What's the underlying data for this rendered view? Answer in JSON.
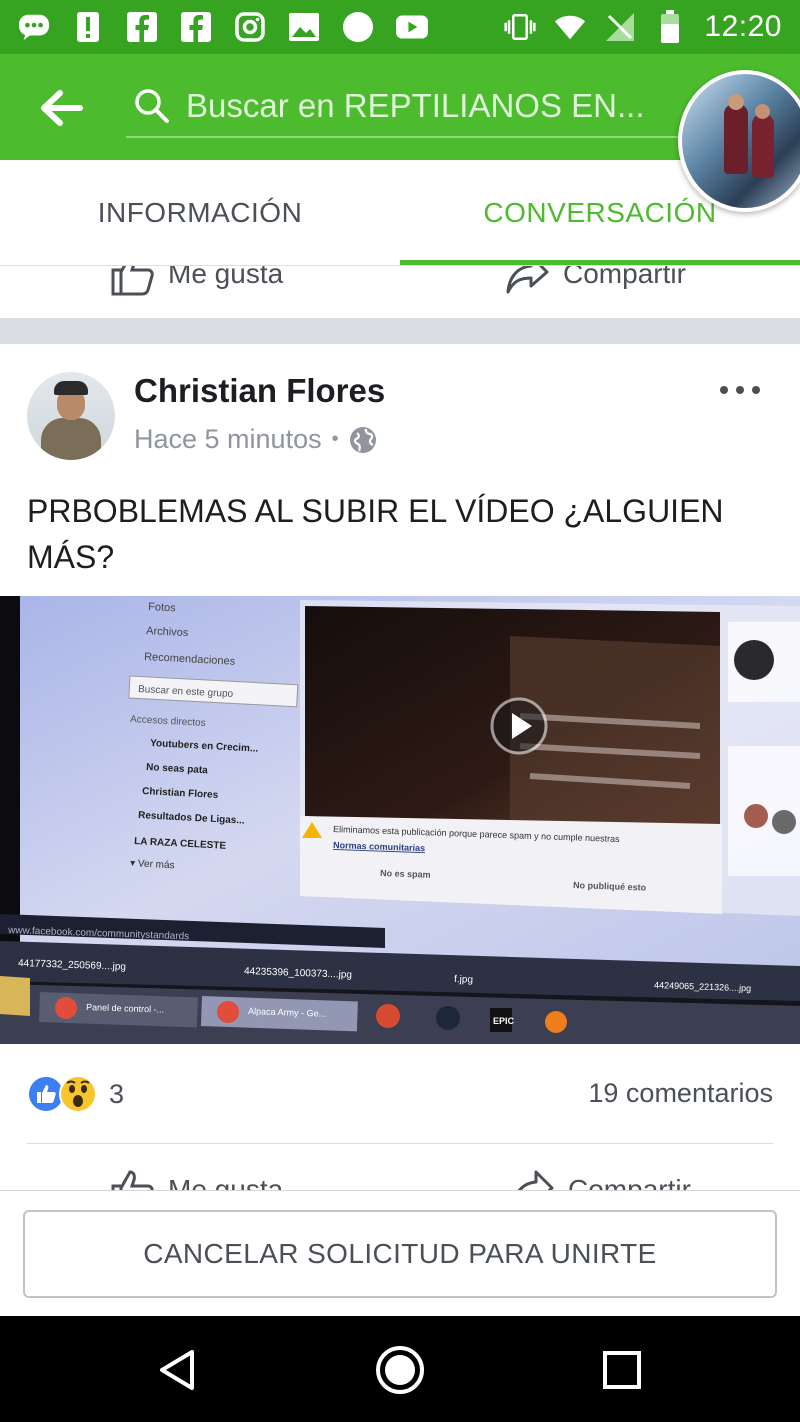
{
  "status_bar": {
    "time": "12:20",
    "icons": [
      "messenger-icon",
      "alert-icon",
      "facebook-icon",
      "facebook-icon",
      "instagram-icon",
      "gallery-icon",
      "circle-icon",
      "youtube-icon",
      "vibrate-icon",
      "wifi-icon",
      "no-signal-icon",
      "battery-icon"
    ]
  },
  "header": {
    "search_placeholder": "Buscar en REPTILIANOS EN..."
  },
  "tabs": [
    {
      "label": "INFORMACIÓN",
      "active": false
    },
    {
      "label": "CONVERSACIÓN",
      "active": true
    }
  ],
  "previous_post": {
    "like_label": "Me gusta",
    "share_label": "Compartir"
  },
  "post": {
    "author": "Christian Flores",
    "time": "Hace 5 minutos",
    "visibility_icon": "globe-icon",
    "text": "PRBOBLEMAS AL SUBIR EL VÍDEO ¿ALGUIEN MÁS?",
    "media": {
      "sidebar_items": [
        "Fotos",
        "Archivos",
        "Recomendaciones"
      ],
      "search_placeholder": "Buscar en este grupo",
      "shortcuts_title": "Accesos directos",
      "shortcuts": [
        "Youtubers en Crecim...",
        "No seas pata",
        "Christian Flores",
        "Resultados De Ligas...",
        "LA RAZA CELESTE"
      ],
      "see_more": "Ver más",
      "notice": "Eliminamos esta publicación porque parece spam y no cumple nuestras",
      "notice_link": "Normas comunitarias",
      "not_spam": "No es spam",
      "didnt_post": "No publiqué esto",
      "url": "www.facebook.com/communitystandards",
      "downloads": [
        "44177332_250569....jpg",
        "44235396_100373....jpg",
        "f.jpg",
        "44249065_221326....jpg"
      ],
      "taskbar": [
        "Panel de control -...",
        "Alpaca Army - Ge..."
      ],
      "epic_label": "EPIC"
    },
    "reaction_count": "3",
    "comments": "19 comentarios",
    "like_label": "Me gusta",
    "share_label": "Compartir"
  },
  "join_button": "CANCELAR SOLICITUD PARA UNIRTE",
  "colors": {
    "status_bar": "#36a420",
    "header": "#4cbb2e",
    "accent": "#4cbb2e",
    "like": "#3b7ff2",
    "wow": "#f7c62f"
  }
}
